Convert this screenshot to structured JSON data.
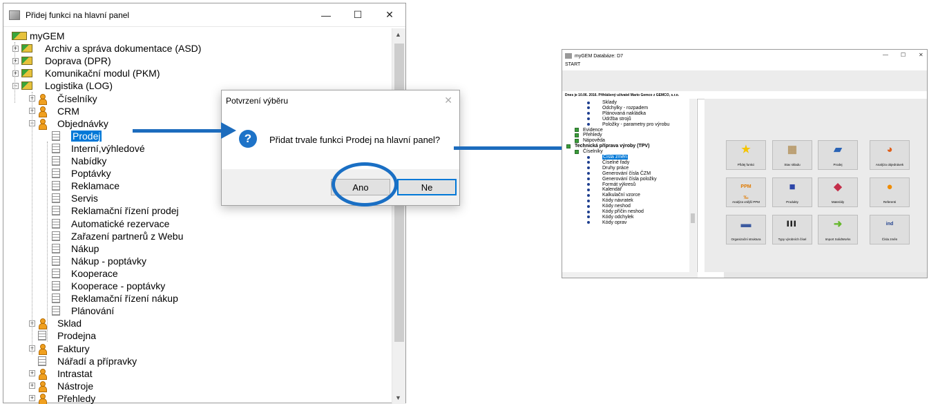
{
  "main_window": {
    "title": "Přidej funkci na hlavní panel",
    "controls": {
      "minimize": "—",
      "maximize": "☐",
      "close": "✕"
    },
    "tree": {
      "root": "myGEM",
      "modules": [
        {
          "label": "Archiv a správa dokumentace (ASD)",
          "state": "+"
        },
        {
          "label": "Doprava (DPR)",
          "state": "+"
        },
        {
          "label": "Komunikační modul (PKM)",
          "state": "+"
        },
        {
          "label": "Logistika (LOG)",
          "state": "−"
        }
      ],
      "logistika_children_top": [
        {
          "label": "Číselníky",
          "state": "+"
        },
        {
          "label": "CRM",
          "state": "+"
        },
        {
          "label": "Objednávky",
          "state": "−"
        }
      ],
      "objednavky_children": [
        "Prodej",
        "Interní,výhledové",
        "Nabídky",
        "Poptávky",
        "Reklamace",
        "Servis",
        "Reklamační řízení prodej",
        "Automatické rezervace",
        "Zařazení partnerů z Webu",
        "Nákup",
        "Nákup - poptávky",
        "Kooperace",
        "Kooperace - poptávky",
        "Reklamační řízení nákup",
        "Plánování"
      ],
      "logistika_children_bottom": [
        {
          "label": "Sklad",
          "type": "user",
          "state": "+"
        },
        {
          "label": "Prodejna",
          "type": "doc",
          "state": ""
        },
        {
          "label": "Faktury",
          "type": "user",
          "state": "+"
        },
        {
          "label": "Nářadí a přípravky",
          "type": "doc",
          "state": ""
        },
        {
          "label": "Intrastat",
          "type": "user",
          "state": "+"
        },
        {
          "label": "Nástroje",
          "type": "user",
          "state": "+"
        },
        {
          "label": "Přehledy",
          "type": "user",
          "state": "+"
        }
      ]
    }
  },
  "dialog": {
    "title": "Potvrzení výběru",
    "close": "✕",
    "icon": "?",
    "message": "Přidat trvale funkci Prodej na hlavní panel?",
    "ok_label": "Ano",
    "cancel_label": "Ne"
  },
  "second_window": {
    "title": "myGEM   Databáze: D7",
    "menu": "START",
    "controls": {
      "minimize": "—",
      "maximize": "☐",
      "close": "✕"
    },
    "status": "Dnes je 10.06. 2016.  Přihlášený uživatel Mario Gemco z GEMCO, s.r.o.",
    "tree_top": [
      "Sklady",
      "Odchylky - rozpadem",
      "Plánovaná nakládka",
      "Údržba strojů",
      "Položky - parametry pro výrobu"
    ],
    "tree_groups": [
      "Evidence",
      "Přehledy",
      "Nápověda"
    ],
    "tree_section": "Technická příprava výroby (TPV)",
    "tree_sub": "Číselníky",
    "tree_bottom": [
      "Čísla změn",
      "Číselné řady",
      "Druhy práce",
      "Generování čísla ČZM",
      "Generování čísla položky",
      "Formát výkresů",
      "Kalendář",
      "Kalkulační vzorce",
      "Kódy návratek",
      "Kódy neshod",
      "Kódy příčin neshod",
      "Kódy odchylek",
      "Kódy oprav"
    ],
    "tiles": [
      {
        "label": "Přidej funkci",
        "glyph": "★",
        "color": "#f5c400"
      },
      {
        "label": "Stav skladu",
        "glyph": "▦",
        "color": "#b89a6a"
      },
      {
        "label": "Prodej",
        "glyph": "▰",
        "color": "#2a63b5"
      },
      {
        "label": "Analýza objednávek",
        "glyph": "◕",
        "color": "#e0601c"
      },
      {
        "label": "Analýza vnější PPM",
        "glyph": "PPM ‰",
        "color": "#e07a00"
      },
      {
        "label": "Produkty",
        "glyph": "■",
        "color": "#2d46a8"
      },
      {
        "label": "Materiály",
        "glyph": "◆",
        "color": "#c42e4a"
      },
      {
        "label": "Referenti",
        "glyph": "●",
        "color": "#f08c00"
      },
      {
        "label": "Organizační struktura",
        "glyph": "▬",
        "color": "#3c5aa0"
      },
      {
        "label": "Typy výrobních čísel",
        "glyph": "▌▌▌",
        "color": "#222222"
      },
      {
        "label": "Import SolidWorks",
        "glyph": "➜",
        "color": "#67b82e"
      },
      {
        "label": "Čísla změn",
        "glyph": "ind",
        "color": "#1e3f8c"
      }
    ]
  },
  "colors": {
    "annotation_blue": "#1d6cbd",
    "selection": "#0078d7"
  }
}
